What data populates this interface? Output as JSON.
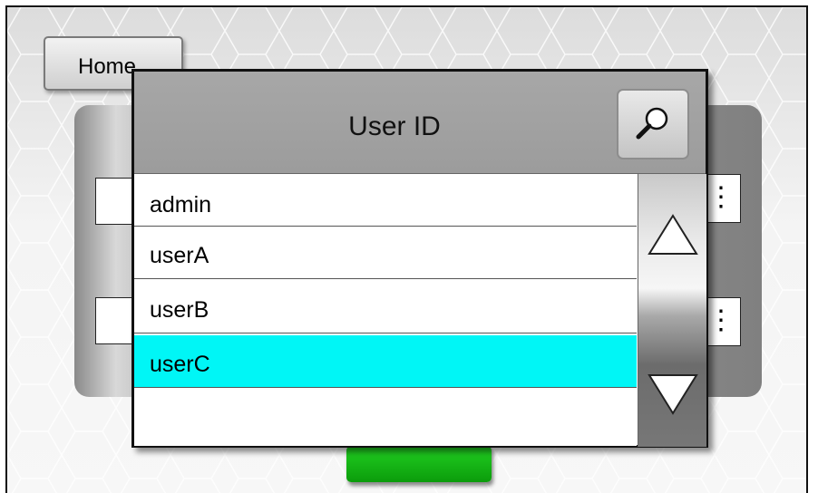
{
  "home": {
    "label": "Home"
  },
  "dialog": {
    "title": "User ID",
    "search_icon": "magnifier-icon",
    "items": [
      {
        "label": "admin",
        "selected": false
      },
      {
        "label": "userA",
        "selected": false
      },
      {
        "label": "userB",
        "selected": false
      },
      {
        "label": "userC",
        "selected": true
      },
      {
        "label": "",
        "selected": false
      }
    ],
    "scroll_up_icon": "triangle-up-icon",
    "scroll_down_icon": "triangle-down-icon"
  },
  "colors": {
    "selection": "#00f6f6",
    "confirm_button": "#11b411",
    "header_gray": "#a3a3a3"
  }
}
